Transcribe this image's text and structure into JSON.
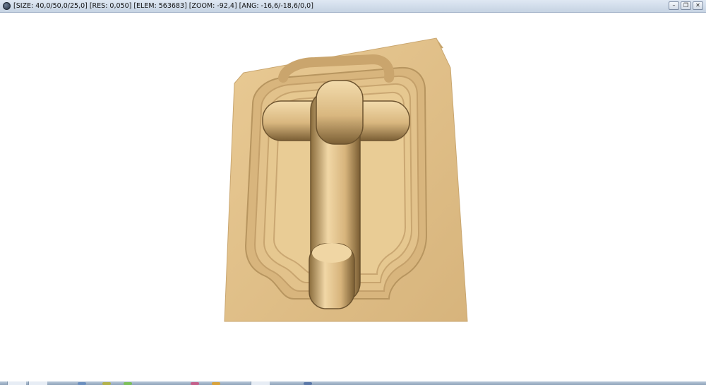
{
  "window": {
    "title": "[SIZE: 40,0/50,0/25,0] [RES: 0,050] [ELEM: 563683] [ZOOM: -92,4] [ANG: -16,6/-18,6/0,0]",
    "app_icon": "app-icon",
    "buttons": [
      {
        "name": "minimize-icon",
        "glyph": "–"
      },
      {
        "name": "restore-icon",
        "glyph": "❐"
      },
      {
        "name": "close-icon",
        "glyph": "✕"
      }
    ]
  },
  "colors": {
    "stock_face": "#e8c68f",
    "stock_side": "#7d6336",
    "stock_top": "#b8975f",
    "background": "#ffffff"
  }
}
